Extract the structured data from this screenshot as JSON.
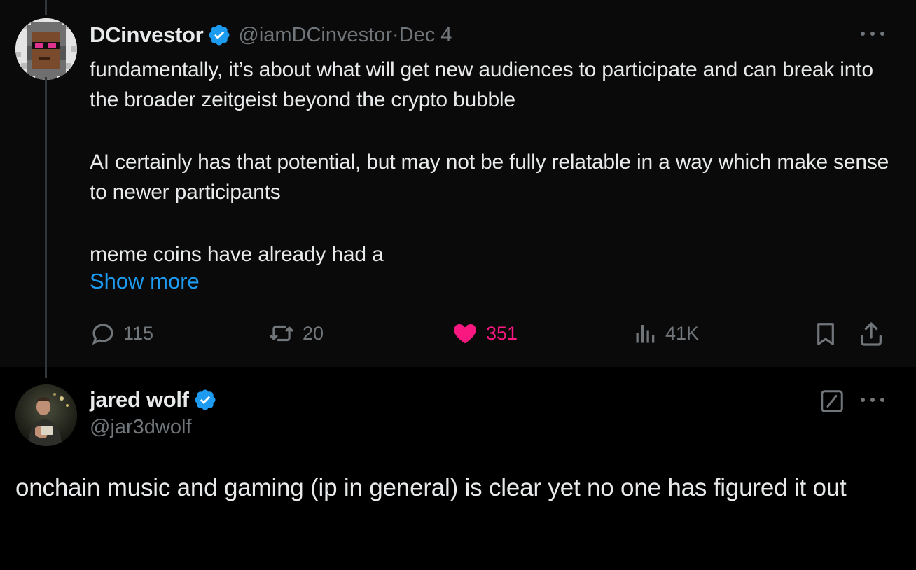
{
  "parent_tweet": {
    "author_name": "DCinvestor",
    "author_handle": "@iamDCinvestor",
    "separator": " · ",
    "date": "Dec 4",
    "paragraphs": [
      "fundamentally, it’s about what will get new audiences to participate and can break into the broader zeitgeist beyond the crypto bubble",
      "AI certainly has that potential, but may not be fully relatable in a way which make sense to newer participants",
      "meme coins have already had a"
    ],
    "show_more": "Show more",
    "stats": {
      "replies": "115",
      "reposts": "20",
      "likes": "351",
      "views": "41K"
    },
    "liked": true
  },
  "reply_tweet": {
    "author_name": "jared wolf",
    "author_handle": "@jar3dwolf",
    "text": "onchain music and gaming (ip in general) is clear yet no one has figured it out"
  },
  "colors": {
    "background": "#000000",
    "parent_background": "#0a0a0a",
    "text": "#e7e9ea",
    "muted": "#71767b",
    "link": "#1d9bf0",
    "like": "#f91880",
    "verified": "#1d9bf0"
  },
  "icons": [
    "verified-badge-icon",
    "more-icon",
    "reply-icon",
    "repost-icon",
    "heart-icon",
    "views-icon",
    "bookmark-icon",
    "share-icon",
    "grok-icon"
  ]
}
